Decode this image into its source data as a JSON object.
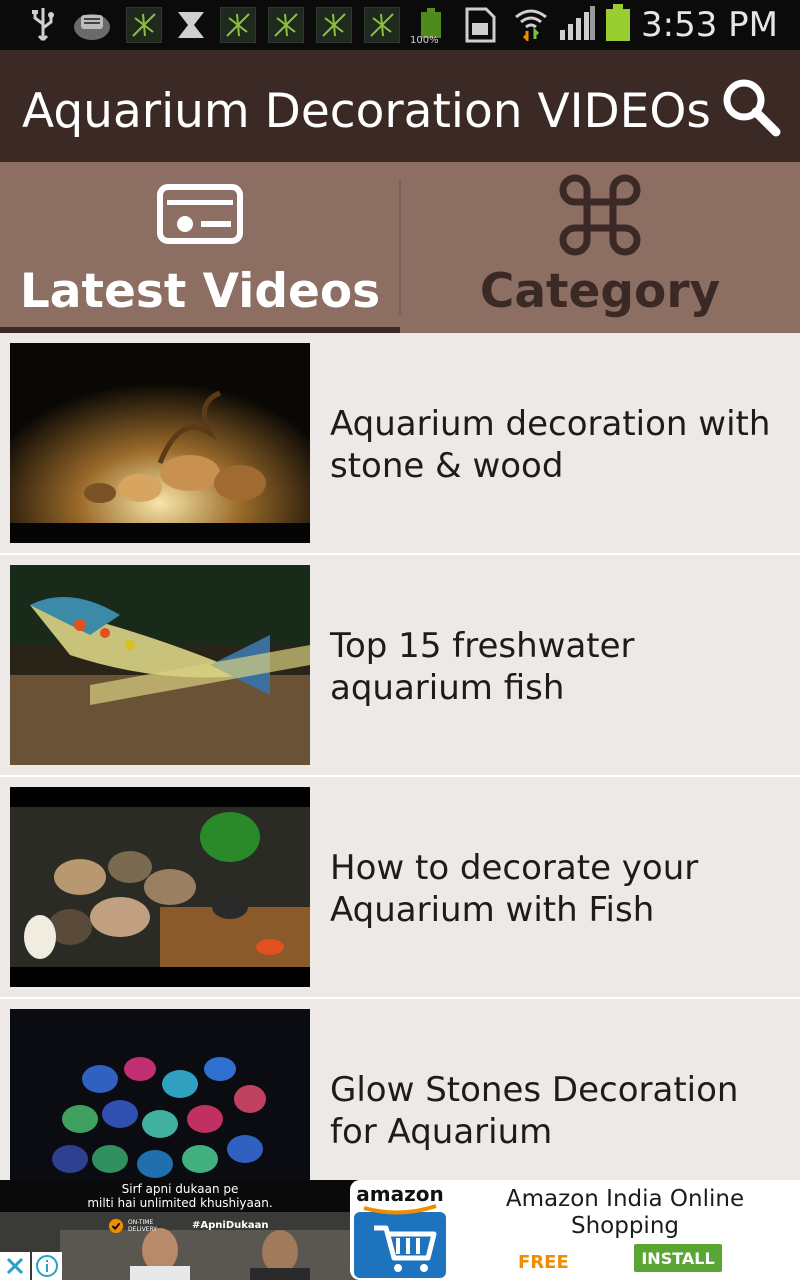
{
  "status_bar": {
    "time": "3:53 PM",
    "battery_small_label": "100%",
    "icons": [
      "usb-icon",
      "storage-app-icon",
      "app-notification-icon",
      "x-notification-icon",
      "app-notification-icon",
      "app-notification-icon",
      "app-notification-icon",
      "app-notification-icon",
      "battery-small-icon",
      "sim-card-icon",
      "wifi-icon",
      "signal-icon",
      "battery-icon"
    ]
  },
  "app_bar": {
    "title": "Aquarium Decoration VIDEOs",
    "search_icon": "search-icon"
  },
  "tabs": [
    {
      "label": "Latest Videos",
      "icon": "video-card-icon",
      "selected": true
    },
    {
      "label": "Category",
      "icon": "command-icon",
      "selected": false
    }
  ],
  "videos": [
    {
      "title": "Aquarium decoration with stone & wood"
    },
    {
      "title": "Top 15 freshwater aquarium fish"
    },
    {
      "title": "How to decorate your Aquarium with Fish"
    },
    {
      "title": "Glow Stones Decoration for Aquarium"
    }
  ],
  "ad": {
    "left_line1": "Sirf apni dukaan pe",
    "left_line2": "milti hai unlimited khushiyaan.",
    "ontime_label": "ON-TIME DELIVERY",
    "hashtag": "#ApniDukaan",
    "logo_text": "amazon",
    "title": "Amazon India Online Shopping",
    "price": "FREE",
    "install_label": "INSTALL"
  },
  "colors": {
    "app_bar": "#3b2925",
    "tabs": "#8d6e63",
    "list_bg": "#ede9e6",
    "install": "#5aa634",
    "free": "#f08c00"
  }
}
